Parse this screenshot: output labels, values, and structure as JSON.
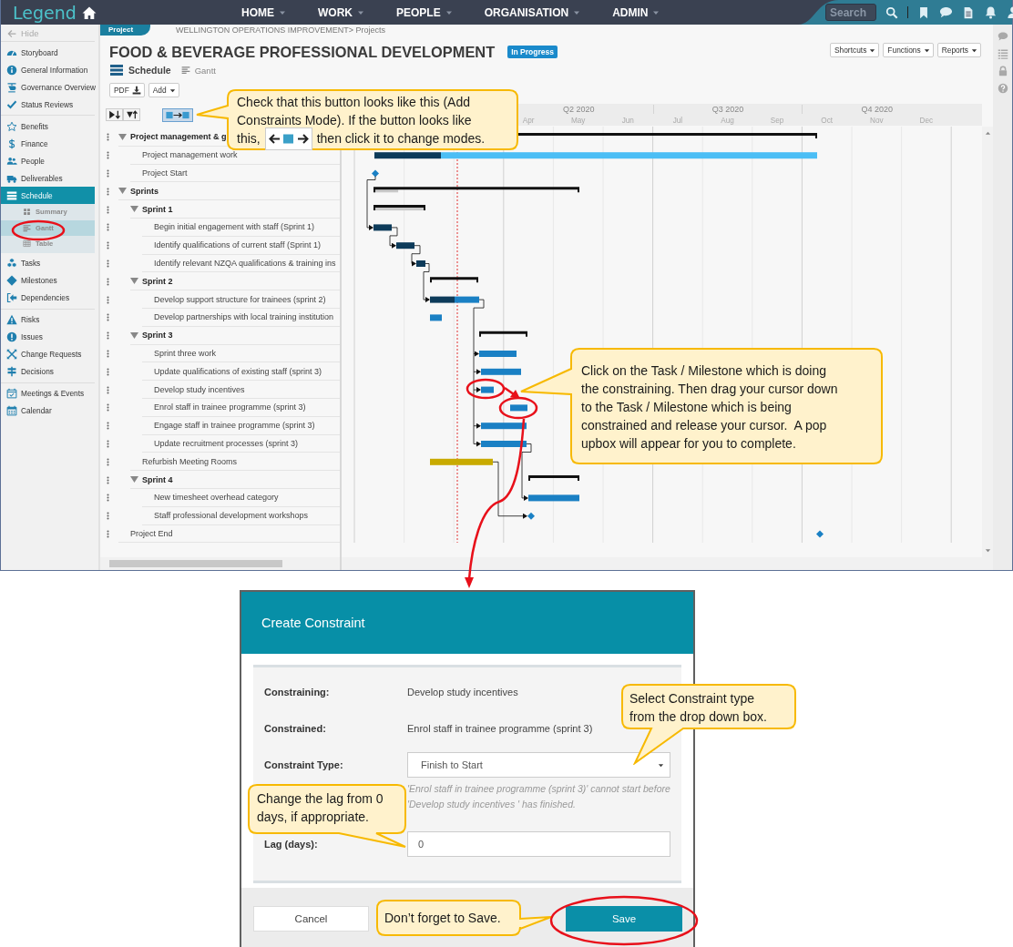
{
  "topbar": {
    "logo": "Legend",
    "nav": [
      {
        "label": "HOME"
      },
      {
        "label": "WORK"
      },
      {
        "label": "PEOPLE"
      },
      {
        "label": "ORGANISATION"
      },
      {
        "label": "ADMIN"
      }
    ],
    "search": {
      "placeholder": "Search"
    }
  },
  "sidebar": {
    "hide": "Hide",
    "groups": [
      [
        {
          "label": "Storyboard",
          "selected": false
        },
        {
          "label": "General Information",
          "selected": false
        },
        {
          "label": "Governance Overview",
          "selected": false
        },
        {
          "label": "Status Reviews",
          "selected": false
        }
      ],
      [
        {
          "label": "Benefits",
          "selected": false
        },
        {
          "label": "Finance",
          "selected": false
        },
        {
          "label": "People",
          "selected": false
        },
        {
          "label": "Deliverables",
          "selected": false
        },
        {
          "label": "Schedule",
          "selected": true,
          "children": [
            {
              "label": "Summary",
              "selected": false
            },
            {
              "label": "Gantt",
              "selected": true
            },
            {
              "label": "Table",
              "selected": false
            }
          ]
        },
        {
          "label": "Tasks",
          "selected": false
        },
        {
          "label": "Milestones",
          "selected": false
        },
        {
          "label": "Dependencies",
          "selected": false
        }
      ],
      [
        {
          "label": "Risks",
          "selected": false
        },
        {
          "label": "Issues",
          "selected": false
        },
        {
          "label": "Change Requests",
          "selected": false
        },
        {
          "label": "Decisions",
          "selected": false
        }
      ],
      [
        {
          "label": "Meetings & Events",
          "selected": false
        },
        {
          "label": "Calendar",
          "selected": false
        }
      ]
    ]
  },
  "breadcrumb": {
    "tab": "Project",
    "path": "WELLINGTON OPERATIONS IMPROVEMENT> Projects"
  },
  "project": {
    "title": "FOOD & BEVERAGE PROFESSIONAL DEVELOPMENT",
    "status": "In Progress",
    "view": "Schedule",
    "subview": "Gantt",
    "buttons": [
      "PDF",
      "Add"
    ],
    "menus": [
      "Shortcuts",
      "Functions",
      "Reports"
    ]
  },
  "gantt": {
    "quarters": [
      {
        "label": "Q2 2020",
        "months": [
          "Apr",
          "May",
          "Jun"
        ]
      },
      {
        "label": "Q3 2020",
        "months": [
          "Jul",
          "Aug",
          "Sep"
        ]
      },
      {
        "label": "Q4 2020",
        "months": [
          "Oct",
          "Nov",
          "Dec"
        ]
      }
    ],
    "tasks": [
      {
        "label": "Project management & g",
        "expanded": true,
        "children": [
          {
            "label": "Project management work"
          },
          {
            "label": "Project Start"
          }
        ]
      },
      {
        "label": "Sprints",
        "expanded": true,
        "level": 0.12,
        "children": [
          {
            "label": "Sprint 1",
            "expanded": true,
            "level": 1,
            "children": [
              {
                "label": "Begin initial engagement with staff (Sprint 1)"
              },
              {
                "label": "Identify qualifications of current staff (Sprint 1)"
              },
              {
                "label": "Identify relevant NZQA qualifications & training ins"
              }
            ]
          },
          {
            "label": "Sprint 2",
            "expanded": true,
            "children": [
              {
                "label": "Develop support structure for trainees (sprint 2)"
              },
              {
                "label": "Develop partnerships with local training institution"
              }
            ]
          },
          {
            "label": "Sprint 3",
            "expanded": true,
            "children": [
              {
                "label": "Sprint three work"
              },
              {
                "label": "Update qualifications of existing staff (sprint 3)"
              },
              {
                "label": "Develop study incentives"
              },
              {
                "label": "Enrol staff in trainee programme (sprint 3)"
              },
              {
                "label": "Engage staff in trainee programme (sprint 3)"
              },
              {
                "label": "Update recruitment processes (sprint 3)"
              }
            ]
          },
          {
            "label": "Refurbish Meeting Rooms"
          },
          {
            "label": "Sprint 4",
            "expanded": true,
            "children": [
              {
                "label": "New timesheet overhead category"
              },
              {
                "label": "Staff professional development workshops"
              }
            ]
          }
        ]
      },
      {
        "label": "Project End"
      }
    ]
  },
  "dialog": {
    "title": "Create Constraint",
    "fields": [
      {
        "kind": "text",
        "label": "Constraining:",
        "value": "Develop study incentives"
      },
      {
        "kind": "text",
        "label": "Constrained:",
        "value": "Enrol staff in trainee programme (sprint 3)"
      },
      {
        "kind": "select",
        "label": "Constraint Type:",
        "value": "Finish to Start",
        "help": "'Enrol staff in trainee programme (sprint 3)' cannot start before 'Develop study incentives ' has finished."
      },
      {
        "kind": "input",
        "label": "Lag (days):",
        "value": "0"
      }
    ],
    "buttons": [
      {
        "kind": "secondary",
        "label": "Cancel"
      },
      {
        "kind": "primary",
        "label": "Save"
      }
    ]
  },
  "callouts": [
    {
      "kind": "icon-note",
      "text_before": "Check that this button looks like this (Add Constraints Mode). If the button looks like",
      "text_mid": "this,",
      "text_after": "then click it to change modes."
    },
    {
      "kind": "note",
      "text": "Click on the Task / Milestone which is doing the constraining. Then drag your cursor down to the Task / Milestone which is being constrained and release your cursor.  A pop upbox will appear for you to complete."
    },
    {
      "kind": "note",
      "text": "Select Constraint type from the drop down box."
    },
    {
      "kind": "note",
      "text": "Change the lag from 0 days, if appropriate."
    },
    {
      "kind": "note",
      "text": "Don’t forget to Save."
    }
  ]
}
